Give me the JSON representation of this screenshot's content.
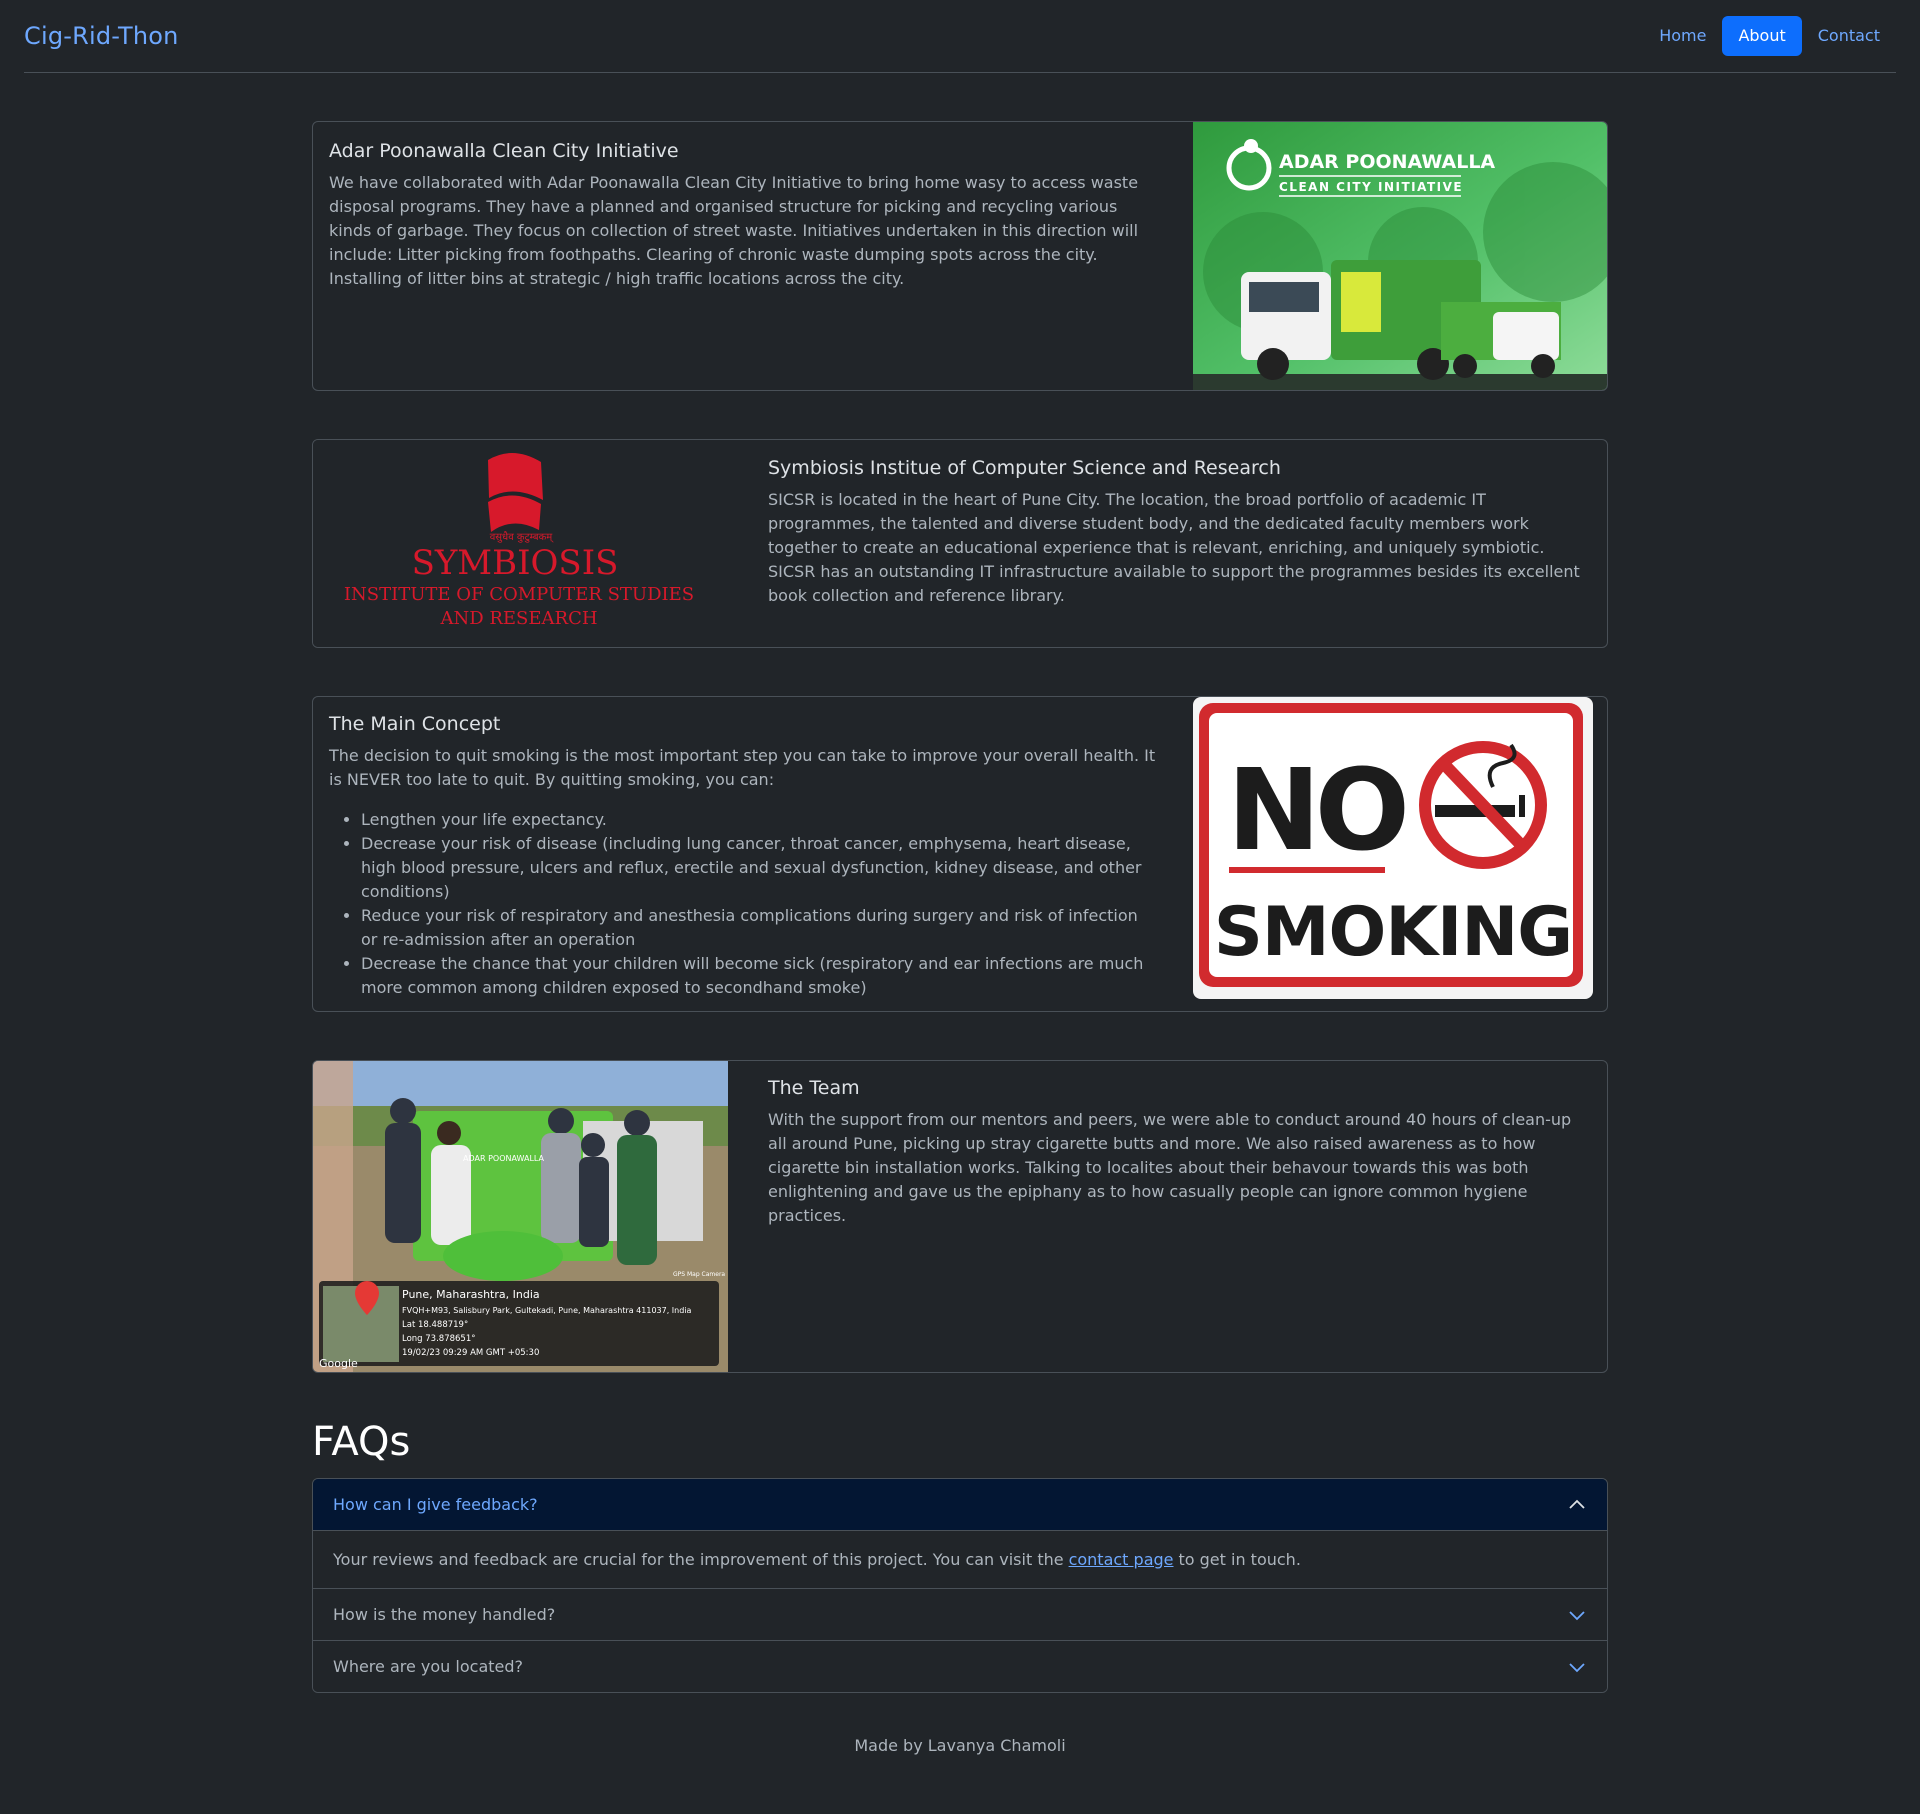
{
  "brand": "Cig-Rid-Thon",
  "nav": {
    "home": "Home",
    "about": "About",
    "contact": "Contact"
  },
  "cards": {
    "adar": {
      "title": "Adar Poonawalla Clean City Initiative",
      "text": "We have collaborated with Adar Poonawalla Clean City Initiative to bring home wasy to access waste disposal programs. They have a planned and organised structure for picking and recycling various kinds of garbage. They focus on collection of street waste. Initiatives undertaken in this direction will include: Litter picking from foothpaths. Clearing of chronic waste dumping spots across the city. Installing of litter bins at strategic / high traffic locations across the city.",
      "logo_line1": "ADAR POONAWALLA",
      "logo_line2": "CLEAN CITY INITIATIVE"
    },
    "sicsr": {
      "title": "Symbiosis Institue of Computer Science and Research",
      "text": "SICSR is located in the heart of Pune City. The location, the broad portfolio of academic IT programmes, the talented and diverse student body, and the dedicated faculty members work together to create an educational experience that is relevant, enriching, and uniquely symbiotic. SICSR has an outstanding IT infrastructure available to support the programmes besides its excellent book collection and reference library.",
      "logo_motto": "वसुधैव कुटुम्बकम्",
      "logo_name": "SYMBIOSIS",
      "logo_sub1": "INSTITUTE OF COMPUTER STUDIES",
      "logo_sub2": "AND RESEARCH"
    },
    "concept": {
      "title": "The Main Concept",
      "text": "The decision to quit smoking is the most important step you can take to improve your overall health. It is NEVER too late to quit. By quitting smoking, you can:",
      "items": [
        "Lengthen your life expectancy.",
        "Decrease your risk of disease (including lung cancer, throat cancer, emphysema, heart disease, high blood pressure, ulcers and reflux, erectile and sexual dysfunction, kidney disease, and other conditions)",
        "Reduce your risk of respiratory and anesthesia complications during surgery and risk of infection or re-admission after an operation",
        "Decrease the chance that your children will become sick (respiratory and ear infections are much more common among children exposed to secondhand smoke)"
      ],
      "sign_no": "NO",
      "sign_smoking": "SMOKING"
    },
    "team": {
      "title": "The Team",
      "text": "With the support from our mentors and peers, we were able to conduct around 40 hours of clean-up all around Pune, picking up stray cigarette butts and more. We also raised awareness as to how cigarette bin installation works. Talking to localites about their behavour towards this was both enlightening and gave us the epiphany as to how casually people can ignore common hygiene practices.",
      "photo_place": "Pune, Maharashtra, India",
      "photo_address": "FVQH+M93, Salisbury Park, Gultekadi, Pune, Maharashtra 411037, India",
      "photo_lat": "Lat 18.488719°",
      "photo_long": "Long 73.878651°",
      "photo_time": "19/02/23 09:29 AM GMT +05:30",
      "photo_google": "Google",
      "photo_cam": "GPS Map Camera",
      "photo_truck": "ADAR POONAWALLA"
    }
  },
  "faq": {
    "title": "FAQs",
    "q1": "How can I give feedback?",
    "a1_before": "Your reviews and feedback are crucial for the improvement of this project. You can visit the",
    "a1_link": "contact page",
    "a1_after": "to get in touch.",
    "q2": "How is the money handled?",
    "q3": "Where are you located?"
  },
  "footer": "Made by Lavanya Chamoli",
  "colors": {
    "background": "#212529",
    "link": "#6ea8fe",
    "primary": "#0d6efd",
    "border": "#495057",
    "accordion_active": "#031633",
    "symbiosis_red": "#d7192b",
    "sign_red": "#d12a2e",
    "adar_green": "#3fae49"
  }
}
